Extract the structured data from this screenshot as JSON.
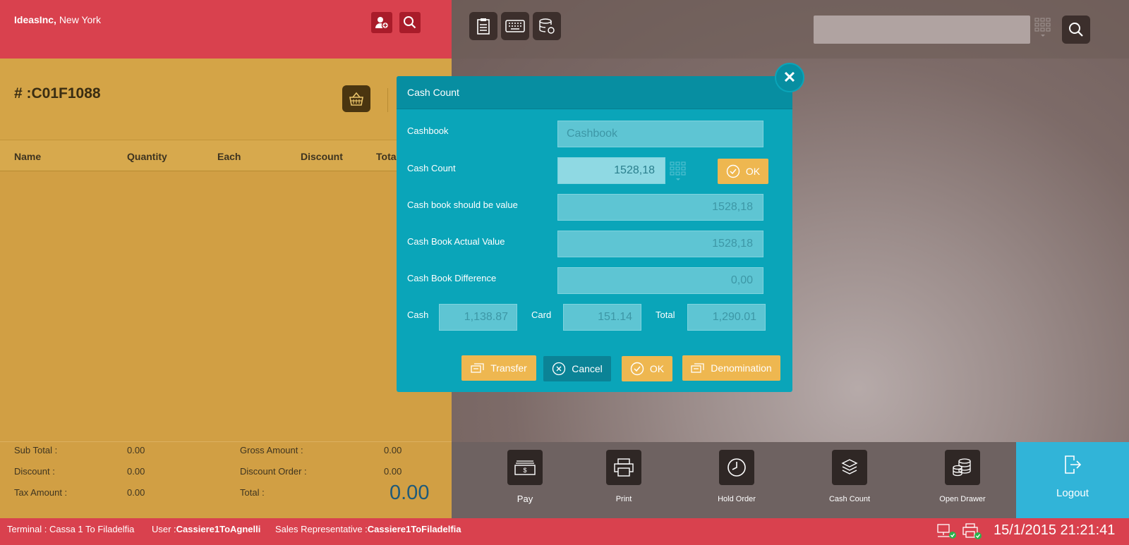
{
  "header": {
    "brand_name": "IdeasInc,",
    "brand_location": "New York"
  },
  "order": {
    "id": "# :C01F1088",
    "columns": [
      "Name",
      "Quantity",
      "Each",
      "Discount",
      "Total"
    ]
  },
  "totals": {
    "sub_total_label": "Sub Total :",
    "sub_total": "0.00",
    "discount_label": "Discount :",
    "discount": "0.00",
    "tax_label": "Tax Amount :",
    "tax": "0.00",
    "gross_label": "Gross Amount :",
    "gross": "0.00",
    "discount_order_label": "Discount Order :",
    "discount_order": "0.00",
    "total_label": "Total :",
    "total": "0.00",
    "grand_total": "0.00"
  },
  "modal": {
    "title": "Cash Count",
    "cashbook_label": "Cashbook",
    "cashbook_placeholder": "Cashbook",
    "cash_count_label": "Cash Count",
    "cash_count_value": "1528,18",
    "should_be_label": "Cash book should be value",
    "should_be_value": "1528,18",
    "actual_label": "Cash Book Actual Value",
    "actual_value": "1528,18",
    "difference_label": "Cash Book Difference",
    "difference_value": "0,00",
    "cash_label": "Cash",
    "cash_value": "1,138.87",
    "card_label": "Card",
    "card_value": "151.14",
    "total_label": "Total",
    "total_value": "1,290.01",
    "ok_inline": "OK",
    "transfer": "Transfer",
    "cancel": "Cancel",
    "ok": "OK",
    "denomination": "Denomination"
  },
  "actions": {
    "pay": "Pay",
    "print": "Print",
    "hold_order": "Hold Order",
    "cash_count": "Cash Count",
    "open_drawer": "Open Drawer",
    "logout": "Logout"
  },
  "status": {
    "terminal_label": "Terminal : Cassa 1 To Filadelfia",
    "user_label": "User :",
    "user_value": "Cassiere1ToAgnelli",
    "sales_rep_label": "Sales Representative :",
    "sales_rep_value": "Cassiere1ToFiladelfia",
    "datetime": "15/1/2015 21:21:41"
  },
  "colors": {
    "header_red": "#d9414e",
    "order_gold": "#d19f44",
    "modal_teal": "#0aa5b9",
    "button_yellow": "#eeb750",
    "logout_blue": "#31b4d8"
  }
}
